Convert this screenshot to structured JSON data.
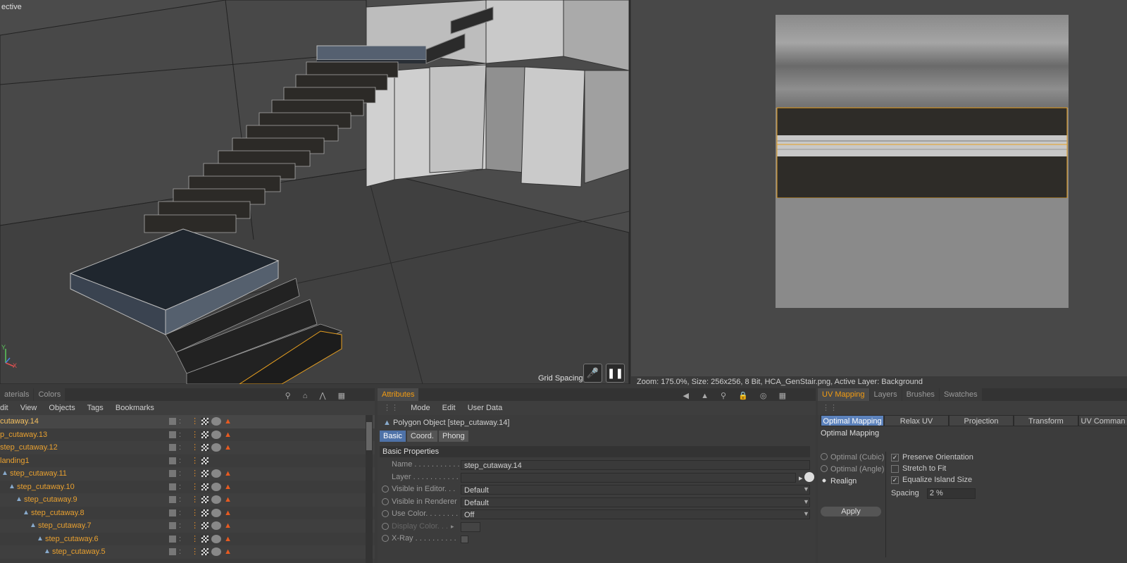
{
  "viewport": {
    "label": "ective",
    "grid_spacing": "Grid Spacing :",
    "axis_y": "Y",
    "axis_x": "X"
  },
  "uv_editor": {
    "status": "Zoom: 175.0%, Size: 256x256, 8 Bit, HCA_GenStair.png, Active Layer: Background"
  },
  "object_manager": {
    "tabs": [
      "aterials",
      "Colors"
    ],
    "menu": [
      "dit",
      "View",
      "Objects",
      "Tags",
      "Bookmarks"
    ],
    "rows": [
      {
        "name": "cutaway.14",
        "indent": 0
      },
      {
        "name": "p_cutaway.13",
        "indent": 0
      },
      {
        "name": "step_cutaway.12",
        "indent": 0
      },
      {
        "name": "landing1",
        "indent": 0
      },
      {
        "name": "step_cutaway.11",
        "indent": 1
      },
      {
        "name": "step_cutaway.10",
        "indent": 2
      },
      {
        "name": "step_cutaway.9",
        "indent": 3
      },
      {
        "name": "step_cutaway.8",
        "indent": 4
      },
      {
        "name": "step_cutaway.7",
        "indent": 5
      },
      {
        "name": "step_cutaway.6",
        "indent": 6
      },
      {
        "name": "step_cutaway.5",
        "indent": 7
      }
    ]
  },
  "attributes": {
    "tab": "Attributes",
    "menu": [
      "Mode",
      "Edit",
      "User Data"
    ],
    "object_title": "Polygon Object [step_cutaway.14]",
    "subtabs": [
      "Basic",
      "Coord.",
      "Phong"
    ],
    "section": "Basic Properties",
    "props": [
      {
        "label": "Name . . . . . . . . . . .",
        "value": "step_cutaway.14"
      },
      {
        "label": "Layer . . . . . . . . . . .",
        "value": ""
      },
      {
        "label": "Visible in Editor. . .",
        "value": "Default"
      },
      {
        "label": "Visible in Renderer",
        "value": "Default"
      },
      {
        "label": "Use Color. . . . . . . .",
        "value": "Off"
      },
      {
        "label": "Display Color. . .",
        "value": ""
      },
      {
        "label": "X-Ray . . . . . . . . . .",
        "value": ""
      }
    ]
  },
  "uv_mapping": {
    "tabs": [
      "UV Mapping",
      "Layers",
      "Brushes",
      "Swatches"
    ],
    "subtabs": [
      "Optimal Mapping",
      "Relax UV",
      "Projection",
      "Transform",
      "UV Comman"
    ],
    "section": "Optimal Mapping",
    "options": [
      "Optimal (Cubic)",
      "Optimal (Angle)",
      "Realign"
    ],
    "checks": [
      {
        "label": "Preserve Orientation",
        "checked": true
      },
      {
        "label": "Stretch to Fit",
        "checked": false
      },
      {
        "label": "Equalize Island Size",
        "checked": true
      }
    ],
    "spacing_label": "Spacing",
    "spacing_value": "2 %",
    "apply_label": "Apply"
  }
}
